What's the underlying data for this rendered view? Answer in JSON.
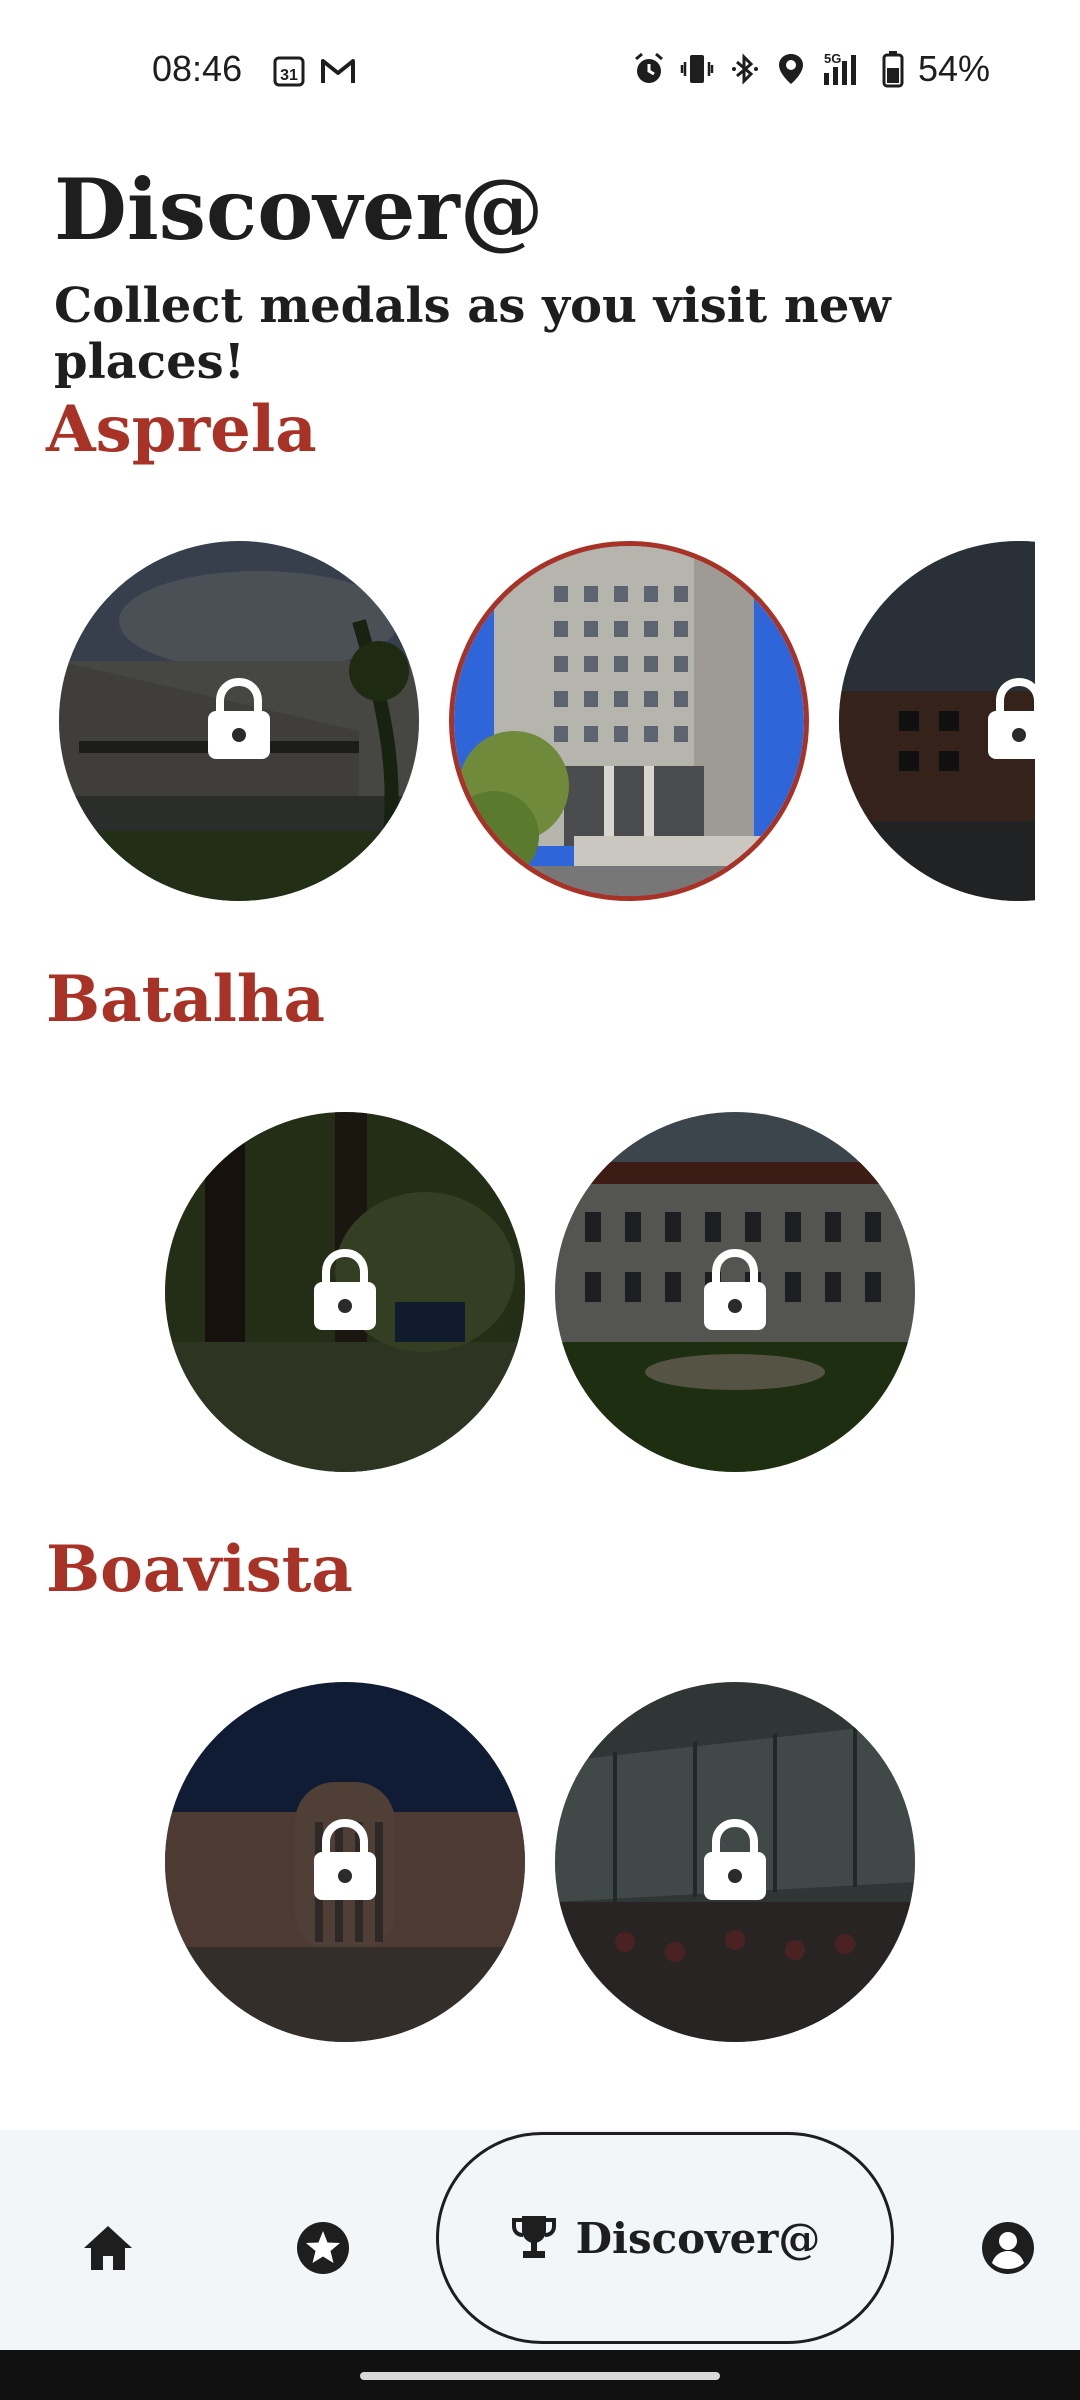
{
  "status_bar": {
    "time": "08:46",
    "calendar_day": "31",
    "network": "5G",
    "battery": "54%"
  },
  "header": {
    "title": "Discover@",
    "subtitle": "Collect medals as you visit new places!"
  },
  "sections": [
    {
      "title": "Asprela",
      "medals": [
        {
          "state": "locked",
          "icon": "lock-icon"
        },
        {
          "state": "unlocked"
        },
        {
          "state": "locked",
          "icon": "lock-icon"
        }
      ]
    },
    {
      "title": "Batalha",
      "medals": [
        {
          "state": "locked",
          "icon": "lock-icon"
        },
        {
          "state": "locked",
          "icon": "lock-icon"
        }
      ]
    },
    {
      "title": "Boavista",
      "medals": [
        {
          "state": "locked",
          "icon": "lock-icon"
        },
        {
          "state": "locked",
          "icon": "lock-icon"
        }
      ]
    }
  ],
  "bottom_nav": {
    "items": [
      {
        "icon": "home-icon"
      },
      {
        "icon": "star-icon"
      },
      {
        "icon": "trophy-icon",
        "label": "Discover@",
        "selected": true
      },
      {
        "icon": "account-icon"
      }
    ]
  },
  "colors": {
    "accent": "#a93226",
    "text": "#1e1e1e",
    "nav_background": "#f2f6f9"
  }
}
